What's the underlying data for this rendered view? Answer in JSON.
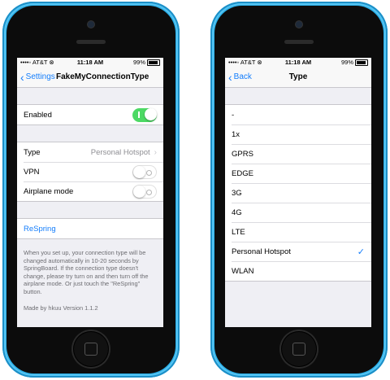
{
  "left_screen": {
    "status": {
      "carrier": "••••◦ AT&T ⊗",
      "time": "11:18 AM",
      "battery": "99%"
    },
    "nav": {
      "back_label": "Settings",
      "title": "FakeMyConnectionType"
    },
    "enabled": {
      "label": "Enabled",
      "on": true
    },
    "type": {
      "label": "Type",
      "value": "Personal Hotspot"
    },
    "vpn": {
      "label": "VPN",
      "on": false
    },
    "airplane": {
      "label": "Airplane mode",
      "on": false
    },
    "respring": {
      "label": "ReSpring"
    },
    "footer": "When you set up, your connection type will be changed automatically in 10-20 seconds by SpringBoard. If the connection type doesn't change, please try turn on and then turn off the airplane mode. Or just touch the \"ReSpring\" button.",
    "footer_cut": "Made by hkuu Version 1.1.2"
  },
  "right_screen": {
    "status": {
      "carrier": "••••◦ AT&T ⊗",
      "time": "11:18 AM",
      "battery": "99%"
    },
    "nav": {
      "back_label": "Back",
      "title": "Type"
    },
    "options": [
      {
        "label": "-"
      },
      {
        "label": "1x"
      },
      {
        "label": "GPRS"
      },
      {
        "label": "EDGE"
      },
      {
        "label": "3G"
      },
      {
        "label": "4G"
      },
      {
        "label": "LTE"
      },
      {
        "label": "Personal Hotspot",
        "selected": true
      },
      {
        "label": "WLAN"
      }
    ]
  },
  "colors": {
    "phone_body": "#2ab0ea",
    "ios_blue": "#157efb",
    "toggle_on": "#4cd964",
    "grouped_bg": "#efeff4"
  }
}
